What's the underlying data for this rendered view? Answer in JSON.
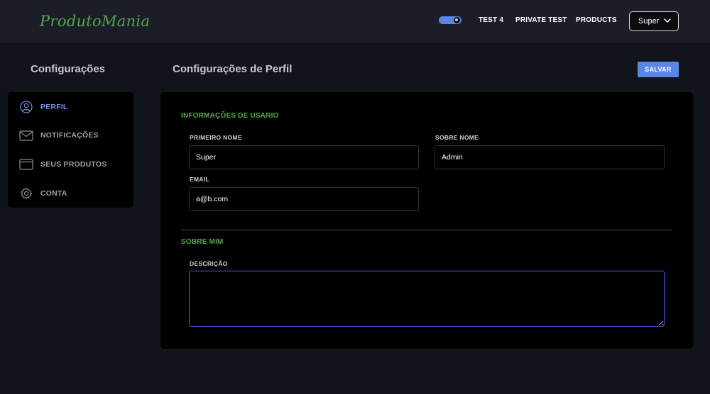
{
  "header": {
    "logo": "ProdutoMania",
    "nav": [
      {
        "label": "TEST 4"
      },
      {
        "label": "PRIVATE TEST"
      },
      {
        "label": "PRODUCTS"
      }
    ],
    "user_menu": {
      "label": "Super"
    }
  },
  "sidebar": {
    "title": "Configurações",
    "items": [
      {
        "label": "PERFIL",
        "icon": "user-circle-icon",
        "active": true
      },
      {
        "label": "NOTIFICAÇÕES",
        "icon": "envelope-icon",
        "active": false
      },
      {
        "label": "SEUS PRODUTOS",
        "icon": "browser-window-icon",
        "active": false
      },
      {
        "label": "CONTA",
        "icon": "gear-icon",
        "active": false
      }
    ]
  },
  "main": {
    "title": "Configurações de Perfil",
    "save_label": "SALVAR",
    "user_info": {
      "section_title": "INFORMAÇÕES DE USARIO",
      "first_name": {
        "label": "PRIMEIRO NOME",
        "value": "Super"
      },
      "last_name": {
        "label": "SOBRE NOME",
        "value": "Admin"
      },
      "email": {
        "label": "EMAIL",
        "value": "a@b.com"
      }
    },
    "about": {
      "section_title": "SOBRE MIM",
      "description": {
        "label": "DESCRIÇÃO",
        "value": ""
      }
    }
  },
  "colors": {
    "accent": "#5b86e5",
    "brand_green": "#55a84a",
    "background": "#12141c",
    "panel": "#000000",
    "textarea_focus": "#4a5ee8"
  }
}
